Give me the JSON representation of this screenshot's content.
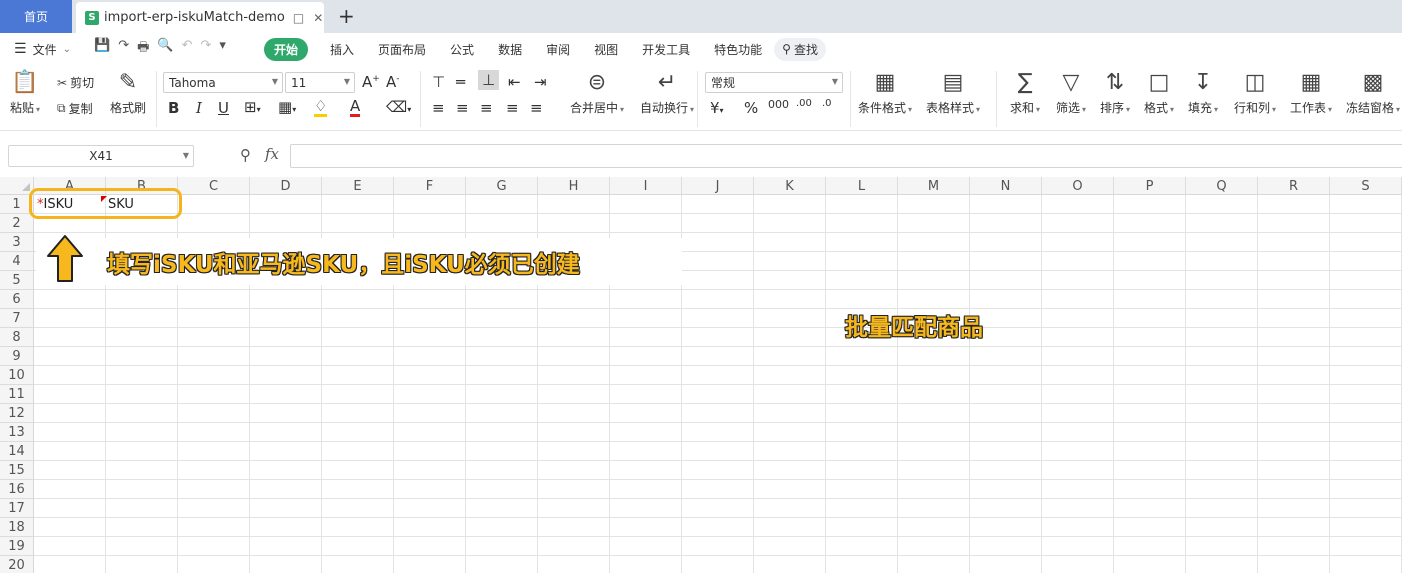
{
  "tabs": {
    "home": "首页",
    "document": "import-erp-iskuMatch-demo",
    "new_tab": "+"
  },
  "menu": {
    "file": "文件",
    "tabs": [
      "开始",
      "插入",
      "页面布局",
      "公式",
      "数据",
      "审阅",
      "视图",
      "开发工具",
      "特色功能"
    ],
    "search": "查找"
  },
  "ribbon": {
    "paste": "粘贴",
    "cut": "剪切",
    "copy": "复制",
    "format_painter": "格式刷",
    "font_name": "Tahoma",
    "font_size": "11",
    "merge_center": "合并居中",
    "wrap_text": "自动换行",
    "number_format": "常规",
    "conditional_format": "条件格式",
    "table_style": "表格样式",
    "sum": "求和",
    "filter": "筛选",
    "sort": "排序",
    "format": "格式",
    "fill": "填充",
    "rows_cols": "行和列",
    "worksheet": "工作表",
    "freeze": "冻结窗格"
  },
  "formula_bar": {
    "cell_ref": "X41",
    "fx": "fx"
  },
  "grid": {
    "columns": [
      "A",
      "B",
      "C",
      "D",
      "E",
      "F",
      "G",
      "H",
      "I",
      "J",
      "K",
      "L",
      "M",
      "N",
      "O",
      "P",
      "Q",
      "R",
      "S"
    ],
    "rows": [
      "1",
      "2",
      "3",
      "4",
      "5",
      "6",
      "7",
      "8",
      "9",
      "10",
      "11",
      "12",
      "13",
      "14",
      "15",
      "16",
      "17",
      "18",
      "19",
      "20"
    ],
    "cells": {
      "A1_star": "*",
      "A1": "ISKU",
      "B1": "SKU"
    }
  },
  "annotations": {
    "instruction": "填写iSKU和亚马逊SKU，且iSKU必须已创建",
    "batch_match": "批量匹配商品"
  },
  "colors": {
    "accent_green": "#2fa86b",
    "home_tab_blue": "#4a78d4",
    "annotation_yellow": "#f7b81e"
  }
}
